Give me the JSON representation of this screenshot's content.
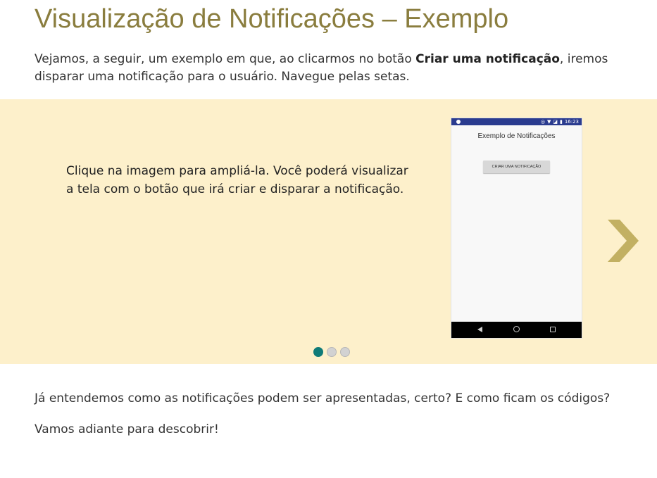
{
  "page": {
    "title": "Visualização de Notificações – Exemplo",
    "intro": {
      "before": "Vejamos, a seguir, um exemplo em que, ao clicarmos no botão ",
      "bold": "Criar uma notificação",
      "after": ", iremos disparar uma notificação para o usuário. Navegue pelas setas."
    },
    "paragraph_1": "Já entendemos como as notificações podem ser apresentadas, certo? E como ficam os códigos?",
    "paragraph_2": "Vamos adiante para descobrir!"
  },
  "carousel": {
    "slide_text": "Clique na imagem para ampliá-la. Você poderá visualizar a tela com o botão que irá criar e disparar a notificação.",
    "next_icon": "chevron-right-icon",
    "total_slides": 3,
    "active_slide": 1,
    "colors": {
      "background": "#fdf0cb",
      "arrow": "#c2b062",
      "active_dot": "#0f7b78",
      "inactive_dot": "#d2d2d2"
    }
  },
  "phone_screenshot": {
    "status_time": "16:23",
    "app_title": "Exemplo de Notificações",
    "button_label": "CRIAR UMA NOTIFICAÇÃO",
    "nav_icons": [
      "back-icon",
      "home-icon",
      "recent-apps-icon"
    ],
    "colors": {
      "status_bar": "#2a3b8f",
      "nav_bar": "#000000"
    }
  }
}
